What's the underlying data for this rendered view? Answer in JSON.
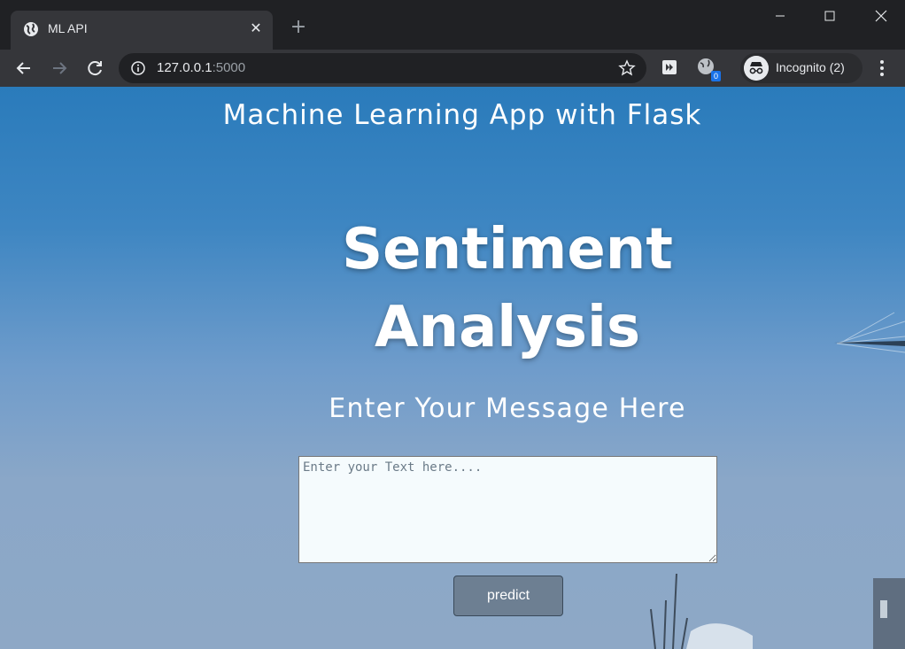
{
  "browser": {
    "tab_title": "ML API",
    "tab_close": "✕",
    "new_tab": "+",
    "url_host": "127.0.0.1",
    "url_port": ":5000",
    "incognito_label": "Incognito (2)",
    "extension_badge": "0"
  },
  "page": {
    "app_title": "Machine Learning App with Flask",
    "heading_line1": "Sentiment",
    "heading_line2": "Analysis",
    "subheading": "Enter Your Message Here",
    "textarea_placeholder": "Enter your Text here....",
    "predict_label": "predict"
  },
  "colors": {
    "sky_top": "#2a7bbb",
    "sky_bottom": "#8ea8c6",
    "button": "#6d7f92"
  }
}
